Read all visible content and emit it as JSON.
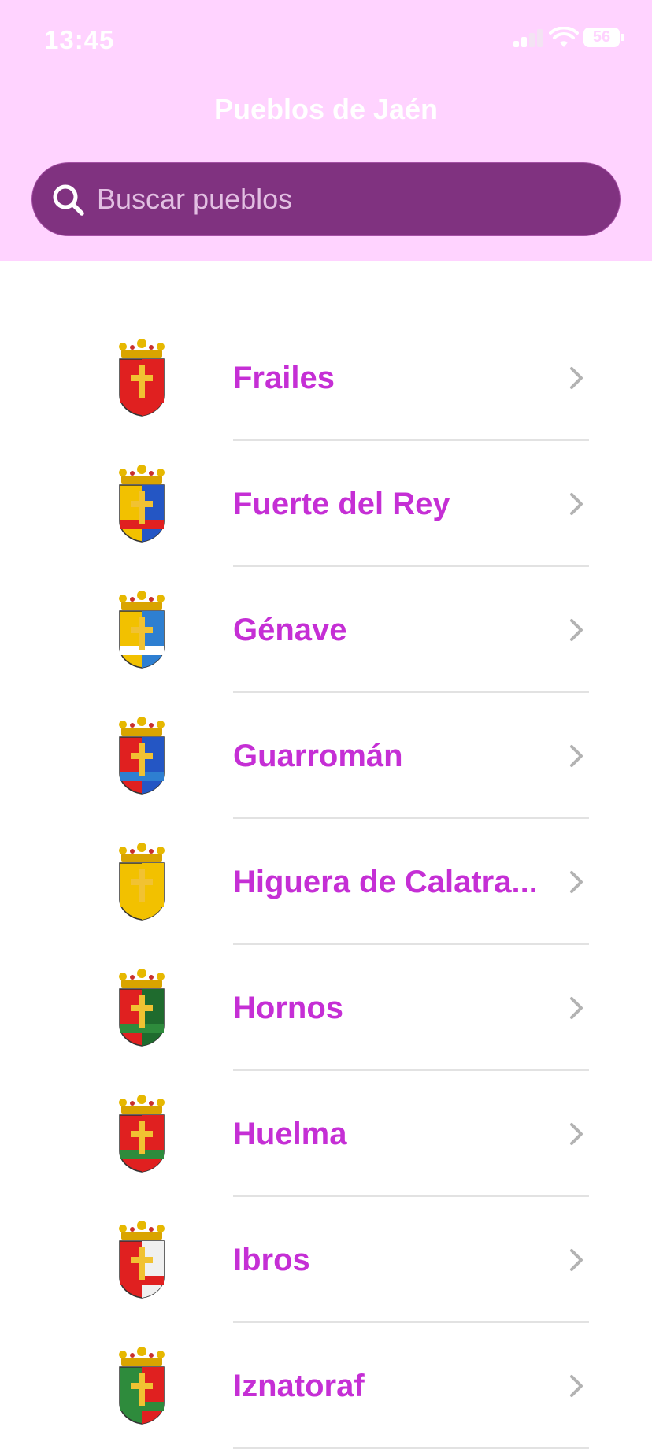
{
  "status_bar": {
    "time": "13:45",
    "battery": "56"
  },
  "nav": {
    "title": "Pueblos de Jaén"
  },
  "search": {
    "placeholder": "Buscar pueblos",
    "value": ""
  },
  "colors": {
    "header_bg": "#ffd3ff",
    "search_bg": "#803280",
    "accent_text": "#c52fd5",
    "chevron": "#b3b3b3"
  },
  "towns": [
    {
      "name": "Frailes",
      "crest": "coat-of-arms-icon"
    },
    {
      "name": "Fuerte del Rey",
      "crest": "coat-of-arms-icon"
    },
    {
      "name": "Génave",
      "crest": "coat-of-arms-icon"
    },
    {
      "name": "Guarromán",
      "crest": "coat-of-arms-icon"
    },
    {
      "name": "Higuera de Calatra...",
      "crest": "coat-of-arms-icon"
    },
    {
      "name": "Hornos",
      "crest": "coat-of-arms-icon"
    },
    {
      "name": "Huelma",
      "crest": "coat-of-arms-icon"
    },
    {
      "name": "Ibros",
      "crest": "coat-of-arms-icon"
    },
    {
      "name": "Iznatoraf",
      "crest": "coat-of-arms-icon"
    }
  ]
}
